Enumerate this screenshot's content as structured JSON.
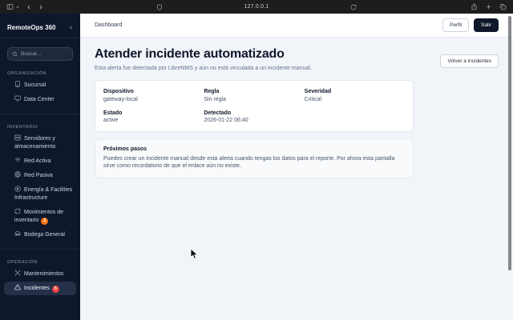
{
  "colors": {
    "sidebar_bg": "#0f172a",
    "sidebar_active_bg": "#233047",
    "page_bg": "#f1f5f9",
    "primary_button_bg": "#0f172a",
    "badge_warning": "#f97316",
    "badge_danger": "#ef4444"
  },
  "browser": {
    "url": "127.0.0.1"
  },
  "sidebar": {
    "title": "RemoteOps 360",
    "search_placeholder": "Buscar...",
    "sections": [
      {
        "label": "ORGANIZACIÓN",
        "items": [
          {
            "label": "Sucursal",
            "icon": "building-icon"
          },
          {
            "label": "Data Center",
            "icon": "monitor-icon"
          }
        ]
      },
      {
        "label": "INVENTARIO",
        "items": [
          {
            "label": "Servidores y almacenamiento",
            "icon": "server-icon"
          },
          {
            "label": "Red Activa",
            "icon": "wifi-icon"
          },
          {
            "label": "Red Pasiva",
            "icon": "globe-icon"
          },
          {
            "label": "Energía & Facilities Infrastructure",
            "icon": "zap-circle-icon"
          },
          {
            "label": "Movimientos de inventario",
            "icon": "refresh-icon",
            "badge": "2"
          },
          {
            "label": "Bodega General",
            "icon": "warehouse-icon"
          }
        ]
      },
      {
        "label": "OPERACIÓN",
        "items": [
          {
            "label": "Mantenimientos",
            "icon": "tools-icon"
          },
          {
            "label": "Incidentes",
            "icon": "alert-triangle-icon",
            "badge": "5",
            "active": true
          }
        ]
      }
    ]
  },
  "topbar": {
    "breadcrumb": "Dashboard",
    "profile_label": "Perfil",
    "logout_label": "Salir"
  },
  "page": {
    "title": "Atender incidente automatizado",
    "subtitle": "Esta alerta fue detectada por LibreNMS y aún no está vinculada a un incidente manual.",
    "back_button": "Volver a incidentes",
    "details": {
      "fields": [
        {
          "label": "Dispositivo",
          "value": "gateway-local"
        },
        {
          "label": "Regla",
          "value": "Sin regla"
        },
        {
          "label": "Severidad",
          "value": "Critical"
        },
        {
          "label": "Estado",
          "value": "active"
        },
        {
          "label": "Detectado",
          "value": "2026-01-22 06:40"
        }
      ]
    },
    "next_steps": {
      "title": "Próximos pasos",
      "body": "Puedes crear un incidente manual desde esta alerta cuando tengas los datos para el reporte. Por ahora esta pantalla sirve como recordatorio de que el enlace aún no existe."
    }
  }
}
